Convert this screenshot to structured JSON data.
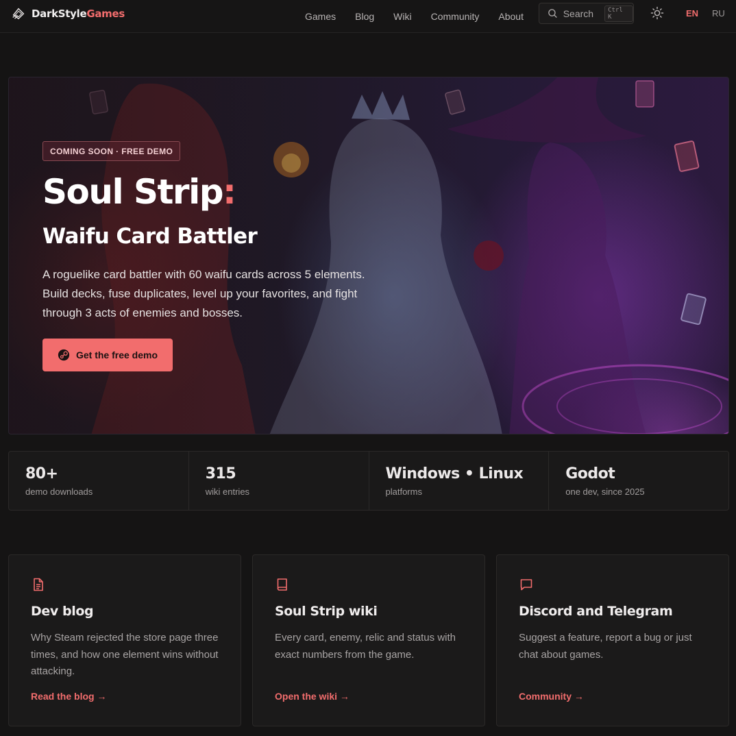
{
  "header": {
    "logo_prefix": "DarkStyle",
    "logo_accent": "Games",
    "nav": [
      "Games",
      "Blog",
      "Wiki",
      "Community",
      "About"
    ],
    "search_label": "Search",
    "search_shortcut": "Ctrl K",
    "theme_icon": "sun-icon",
    "lang_active": "EN",
    "lang_other": "RU"
  },
  "hero": {
    "badge": "COMING SOON · FREE DEMO",
    "title": "Soul Strip",
    "title_colon": ":",
    "subtitle": "Waifu Card Battler",
    "description": "A roguelike card battler with 60 waifu cards across 5 elements. Build decks, fuse duplicates, level up your favorites, and fight through 3 acts of enemies and bosses.",
    "cta_label": "Get the free demo",
    "cta_icon": "steam-icon"
  },
  "stats": [
    {
      "value": "80+",
      "label": "demo downloads"
    },
    {
      "value": "315",
      "label": "wiki entries"
    },
    {
      "value": "Windows • Linux",
      "label": "platforms"
    },
    {
      "value": "Godot",
      "label": "one dev, since 2025"
    }
  ],
  "cards": [
    {
      "icon": "document-icon",
      "title": "Dev blog",
      "description": "Why Steam rejected the store page three times, and how one element wins without attacking.",
      "link": "Read the blog →"
    },
    {
      "icon": "book-icon",
      "title": "Soul Strip wiki",
      "description": "Every card, enemy, relic and status with exact numbers from the game.",
      "link": "Open the wiki →"
    },
    {
      "icon": "chat-icon",
      "title": "Discord and Telegram",
      "description": "Suggest a feature, report a bug or just chat about games.",
      "link": "Community →"
    }
  ],
  "colors": {
    "accent": "#f26d6d",
    "background": "#151414",
    "card_background": "#1b1a1a"
  }
}
